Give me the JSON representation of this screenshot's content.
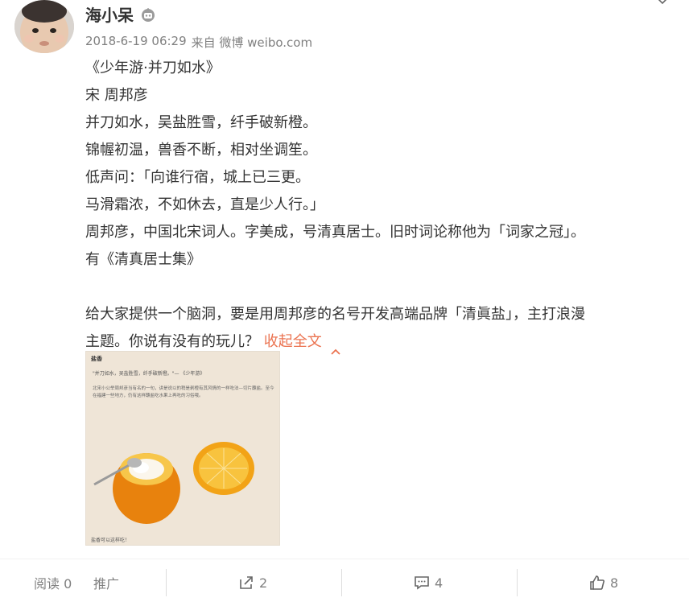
{
  "user": {
    "name": "海小呆",
    "badge_icon": "robot-badge-icon"
  },
  "meta": {
    "date": "2018-6-19 06:29",
    "source": "来自 微博 weibo.com"
  },
  "content": {
    "lines": [
      "《少年游·并刀如水》",
      "宋 周邦彦",
      "并刀如水，吴盐胜雪，纤手破新橙。",
      "锦幄初温，兽香不断，相对坐调笙。",
      "低声问：「向谁行宿，城上已三更。",
      "马滑霜浓，不如休去，直是少人行。」",
      "周邦彦，中国北宋词人。字美成，号清真居士。旧时词论称他为「词家之冠」。",
      "有《清真居士集》"
    ],
    "paragraph2_line1": "给大家提供一个脑洞，要是用周邦彦的名号开发高端品牌「清眞盐」，主打浪漫",
    "paragraph2_line2": "主题。你说有没有的玩儿？",
    "collapse_label": "收起全文"
  },
  "image": {
    "title": "盐香",
    "quote": "\"并刀如水，吴盐胜雪，纤手破新橙。\"— 《少年游》",
    "paragraph": "北宋小公举周邦彦当有名的一句，讲是说以的稍是剥橙有其风情的一样吃法—切片蘸盐。至今在福建一些地方，仍有这样蘸盐吃水果上再吃的习俗哦。",
    "footer": "盐香可以这样吃！"
  },
  "actions": {
    "read_label": "阅读 0",
    "promote_label": "推广",
    "repost_count": "2",
    "comment_count": "4",
    "like_count": "8"
  },
  "colors": {
    "link": "#eb7350",
    "text": "#333333",
    "muted": "#808080"
  }
}
